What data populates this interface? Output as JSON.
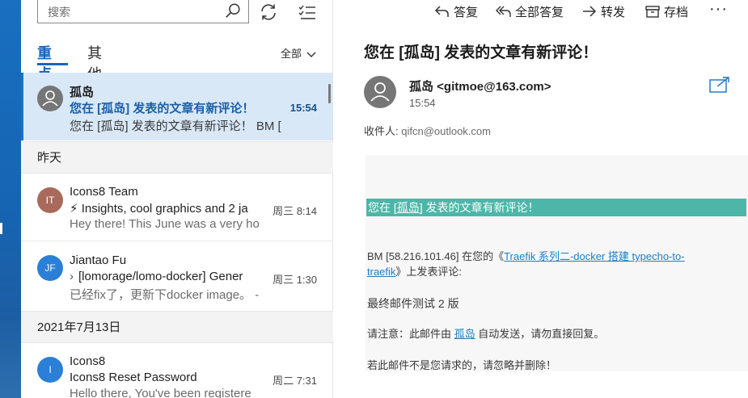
{
  "search": {
    "placeholder": "搜索"
  },
  "tabs": {
    "focused": "重点",
    "other": "其他"
  },
  "filter": {
    "label": "全部"
  },
  "mails": [
    {
      "sender": "孤岛",
      "subject": "您在 [孤岛] 发表的文章有新评论！",
      "preview": "您在 [孤岛] 发表的文章有新评论！ BM [",
      "time": "15:54"
    },
    {
      "initials": "IT",
      "sender": "Icons8 Team",
      "subject": "⚡ Insights, cool graphics and 2 ja",
      "preview": "Hey there! This June was a very ho",
      "time": "周三 8:14"
    },
    {
      "initials": "JF",
      "sender": "Jiantao Fu",
      "subject": "[lomorage/lomo-docker] Gener",
      "preview": "已经fix了，更新下docker image。 -",
      "time": "周三 1:30"
    },
    {
      "initials": "I",
      "sender": "Icons8",
      "subject": "Icons8 Reset Password",
      "preview": "Hello there, You've been registere",
      "time": "周二 7:31"
    }
  ],
  "groups": {
    "yesterday": "昨天",
    "date": "2021年7月13日"
  },
  "actions": {
    "reply": "答复",
    "reply_all": "全部答复",
    "forward": "转发",
    "archive": "存档",
    "more": "···"
  },
  "reading": {
    "title": "您在 [孤岛] 发表的文章有新评论！",
    "from": "孤岛 <gitmoe@163.com>",
    "time": "15:54",
    "to_label": "收件人: ",
    "to_addr": "qifcn@outlook.com",
    "banner_prefix": "您在 [",
    "banner_link": "孤岛",
    "banner_suffix": "] 发表的文章有新评论！",
    "line1_prefix": "BM [58.216.101.46] 在您的《",
    "line1_link_a": "Traefik 系列二-docker 搭建 typecho-to-",
    "line1_link_b": "traefik",
    "line1_suffix": "》上发表评论:",
    "comment": "最终邮件测试 2 版",
    "notice_prefix": "请注意：此邮件由 ",
    "notice_link": "孤岛",
    "notice_suffix": " 自动发送，请勿直接回复。",
    "ignore": "若此邮件不是您请求的，请忽略并删除！"
  },
  "colors": {
    "accent": "#1565c0",
    "banner": "#4db6a8",
    "selected_bg": "#d9e8f7"
  }
}
